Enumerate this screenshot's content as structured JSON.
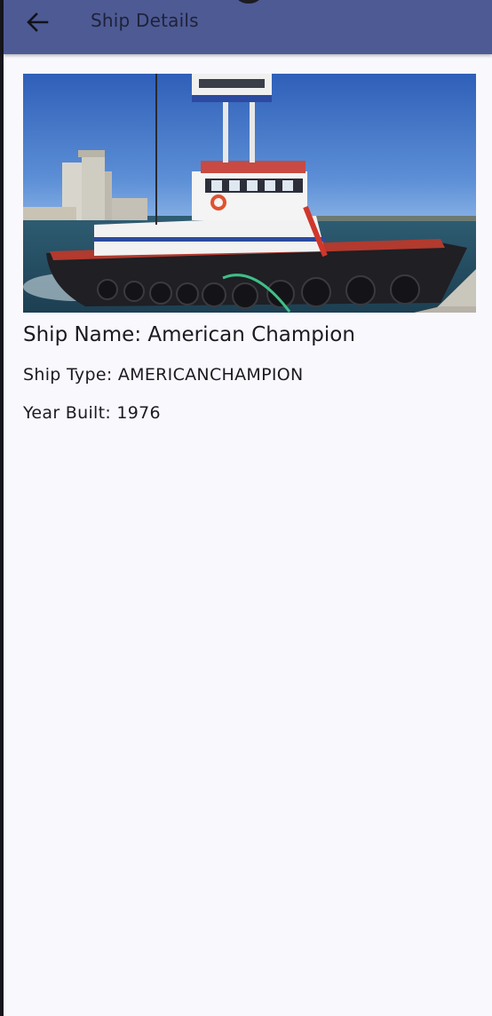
{
  "app_bar": {
    "title": "Ship Details",
    "back_icon": "arrow-back-icon",
    "background_color": "#4e5a94"
  },
  "ship": {
    "name_text": "Ship Name: American Champion",
    "type_text": "Ship Type: AMERICANCHAMPION",
    "year_text": "Year Built: 1976",
    "image_subject": "tugboat-photo"
  },
  "colors": {
    "screen_background": "#f8f8fd",
    "text": "#1b1b21"
  }
}
